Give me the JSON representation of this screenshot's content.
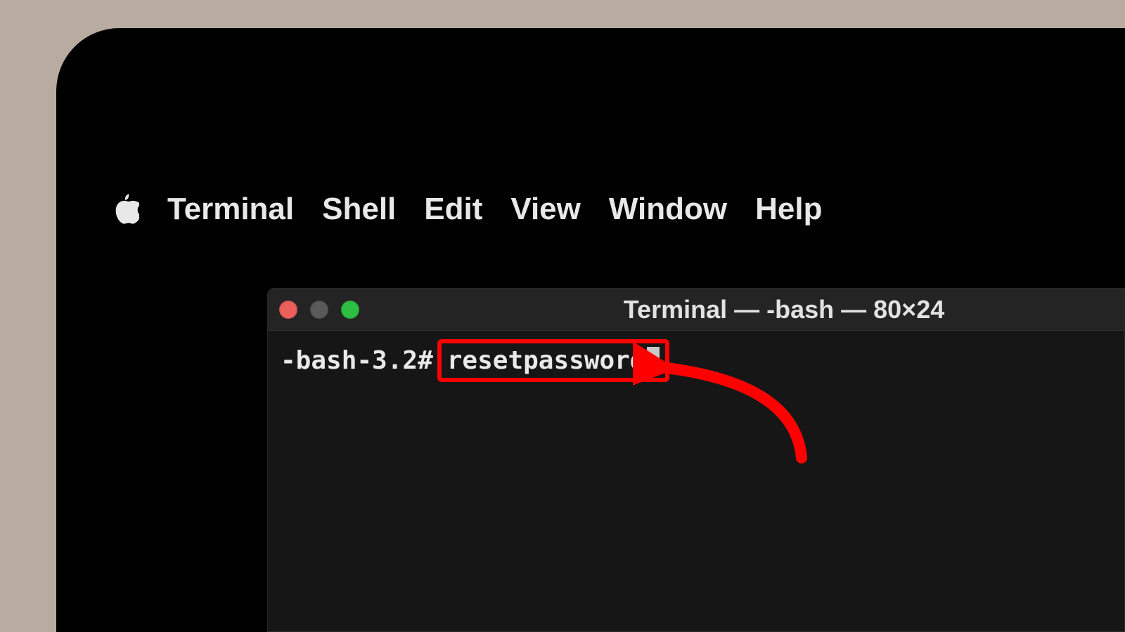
{
  "menubar": {
    "appName": "Terminal",
    "items": [
      "Shell",
      "Edit",
      "View",
      "Window",
      "Help"
    ]
  },
  "terminal": {
    "windowTitle": "Terminal — -bash — 80×24",
    "prompt": "-bash-3.2#",
    "command": "resetpassword"
  },
  "annotation": {
    "highlightColor": "#ff0000"
  }
}
